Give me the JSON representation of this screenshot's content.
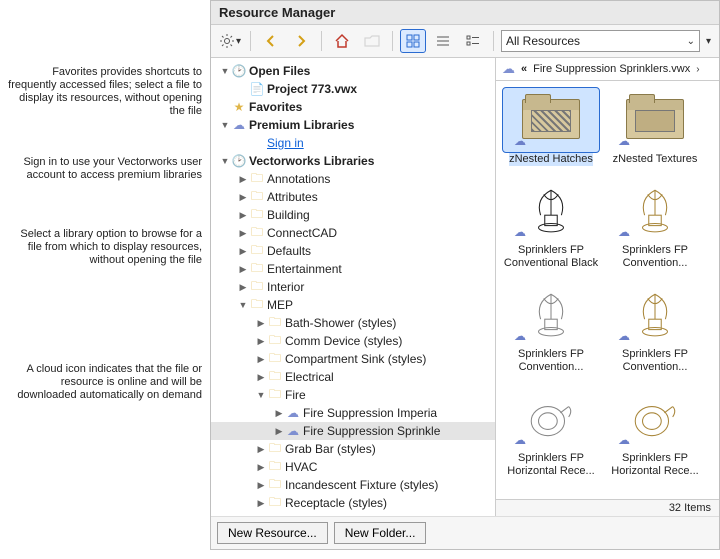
{
  "window": {
    "title": "Resource Manager"
  },
  "toolbar": {
    "resource_filter": "All Resources"
  },
  "callouts": {
    "favorites": "Favorites provides shortcuts to frequently accessed files; select a file to display its resources, without opening the file",
    "signin": "Sign in to use your Vectorworks user account to access premium libraries",
    "library": "Select a library option to browse for a file from which to display resources, without opening the file",
    "cloud": "A cloud icon indicates that the file or resource is online and will be downloaded automatically on demand"
  },
  "tree": {
    "open_files": "Open Files",
    "project": "Project 773.vwx",
    "favorites": "Favorites",
    "premium": "Premium Libraries",
    "sign_in": "Sign in",
    "vw_libs": "Vectorworks Libraries",
    "folders": [
      "Annotations",
      "Attributes",
      "Building",
      "ConnectCAD",
      "Defaults",
      "Entertainment",
      "Interior"
    ],
    "mep": "MEP",
    "mep_children": [
      "Bath-Shower (styles)",
      "Comm Device (styles)",
      "Compartment Sink (styles)",
      "Electrical"
    ],
    "fire": "Fire",
    "fire_children": [
      "Fire Suppression Imperia",
      "Fire Suppression Sprinkle"
    ],
    "after_fire": [
      "Grab Bar (styles)",
      "HVAC",
      "Incandescent Fixture (styles)",
      "Receptacle (styles)"
    ]
  },
  "breadcrumb": {
    "back": "«",
    "path": "Fire Suppression Sprinklers.vwx",
    "fwd": "›"
  },
  "gallery": {
    "items": [
      {
        "name": "zNested Hatches",
        "kind": "folder-hatch"
      },
      {
        "name": "zNested Textures",
        "kind": "folder-tex"
      },
      {
        "name": "Sprinklers FP Conventional Black",
        "kind": "sprinkler",
        "color": "#222"
      },
      {
        "name": "Sprinklers FP Convention...",
        "kind": "sprinkler",
        "color": "#a8863a"
      },
      {
        "name": "Sprinklers FP Convention...",
        "kind": "sprinkler",
        "color": "#888"
      },
      {
        "name": "Sprinklers FP Convention...",
        "kind": "sprinkler",
        "color": "#a8863a"
      },
      {
        "name": "Sprinklers FP Horizontal Rece...",
        "kind": "disc",
        "color": "#888"
      },
      {
        "name": "Sprinklers FP Horizontal Rece...",
        "kind": "disc",
        "color": "#a8863a"
      }
    ],
    "count_label": "32 Items"
  },
  "footer": {
    "new_resource": "New Resource...",
    "new_folder": "New Folder..."
  }
}
